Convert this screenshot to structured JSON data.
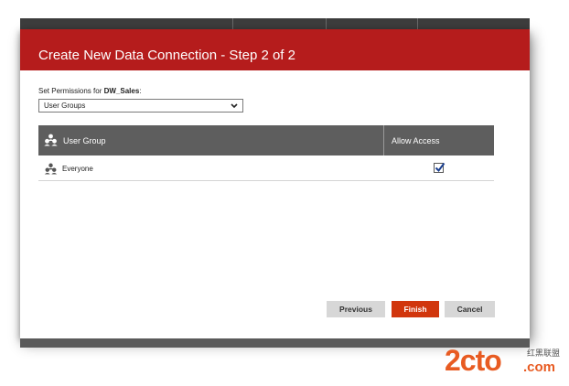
{
  "dialog": {
    "title": "Create New Data Connection - Step 2 of 2",
    "permissions_label_prefix": "Set Permissions for ",
    "permissions_target": "DW_Sales",
    "permissions_label_suffix": ":",
    "select_value": "User Groups"
  },
  "table": {
    "col_user_group": "User Group",
    "col_allow_access": "Allow Access",
    "rows": [
      {
        "name": "Everyone",
        "allow_access": true
      }
    ]
  },
  "buttons": {
    "previous": "Previous",
    "finish": "Finish",
    "cancel": "Cancel"
  },
  "watermark": {
    "main": "2cto",
    "chinese": "红黑联盟",
    "domain": ".com"
  },
  "colors": {
    "header_red": "#b51c1c",
    "finish_orange": "#d1360d",
    "table_header_gray": "#5e5e5e",
    "watermark_orange": "#e85b22"
  },
  "icons": {
    "group": "user-group-icon",
    "dropdown": "chevron-down-icon",
    "checkbox": "checkmark-icon"
  }
}
